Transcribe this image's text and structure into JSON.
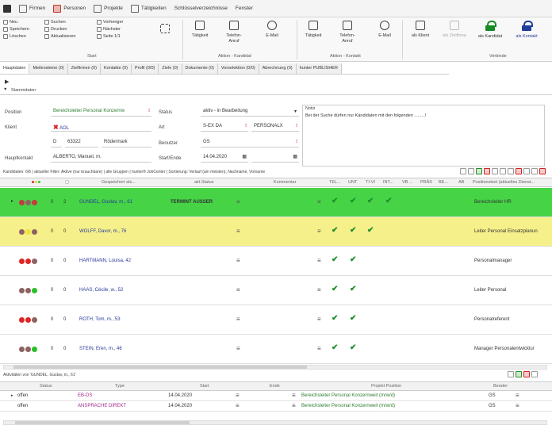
{
  "menubar": {
    "items": [
      "Firmen",
      "Personen",
      "Projekte",
      "Tätigkeiten",
      "Schlüsselverzeichnisse",
      "Fenster"
    ]
  },
  "ribbon": {
    "col1": [
      "Neu",
      "Speichern",
      "Löschen"
    ],
    "col2": [
      "Suchen",
      "Drucken",
      "Aktualisieren"
    ],
    "col3": [
      "Vorheriger",
      "Nächster",
      "Seite 1/1"
    ],
    "start_label": "Start",
    "kandidat_buttons": [
      {
        "label": "Tätigkeit"
      },
      {
        "label": "Telefon-Anruf"
      },
      {
        "label": "E-Mail"
      }
    ],
    "kandidat_label": "Aktion - Kandidat",
    "kontakt_buttons": [
      {
        "label": "Tätigkeit"
      },
      {
        "label": "Telefon-Anruf"
      },
      {
        "label": "E-Mail"
      }
    ],
    "kontakt_label": "Aktion - Kontakt",
    "klient": "als Klient",
    "zielfirma": "als Zielfirma",
    "kandidat": "als Kandidat",
    "kontakt": "als Kontakt",
    "verbinde_label": "Verbinde"
  },
  "tabs": [
    "Hauptdaten",
    "Meilensteine (0)",
    "Zielfirmen (0)",
    "Kontakte (0)",
    "Profil (0/0)",
    "Ziele (0)",
    "Dokumente (0)",
    "Vorselektion (0/0)",
    "Abrechnung (0)",
    "hunter PUBLISHER"
  ],
  "section": {
    "title": "Stammdaten"
  },
  "form": {
    "position_label": "Position",
    "position_value": "Bereichsleiter Personal Konzernw",
    "klient_label": "Klient",
    "klient_value": "AOL",
    "klient_country": "D",
    "klient_zip": "63322",
    "klient_city": "Rödermark",
    "hauptkontakt_label": "Hauptkontakt",
    "hauptkontakt_value": "ALBERTO, Manuel, m.",
    "status_label": "Status",
    "status_value": "aktiv - in Bearbeitung",
    "art_label": "Art",
    "art_value1": "S-EX DA",
    "art_value2": "PERSONALX",
    "benutzer_label": "Benutzer",
    "benutzer_value": "GS",
    "start_label": "Start/Ende",
    "start_value": "14.04.2020",
    "notes_label": "Notiz",
    "notes_value": "Bei der Suche dürfen nur Kandidaten mit den folgenden .........!"
  },
  "filter_text": "Kandidaten: 6/6 | aktueller Filter: Aktive (nur brauchbare) | alle Gruppen | hunter® JobCenter | Sortierung: Verlauf (am meisten), Nachname, Vorname",
  "grid": {
    "headers": [
      "Gespeichert als...",
      "akt.Status",
      "Kommentar",
      "TEL...",
      "UNT",
      "TI-VI",
      "INT...",
      "VB ...",
      "PRÄS",
      "BE...",
      "AB",
      "Positionstext (aktuelles Dienst..."
    ],
    "rows": [
      {
        "count": "0",
        "num": "2",
        "name": "GUNDEL, Gustav, m., 61",
        "status": "TERMINT AUSSER",
        "position": "Bereichsleiter HR",
        "checks": 4,
        "color": "#46d346",
        "dots": [
          "#c43b3b",
          "#8e6262",
          "#c43b3b"
        ]
      },
      {
        "count": "0",
        "num": "0",
        "name": "WOLFF, Davor, m., 76",
        "status": "",
        "position": "Leiter Personal Einsatzplanun",
        "checks": 3,
        "color": "#f5f08a",
        "dots": [
          "#8e6262",
          "#f3e13c",
          "#8e6262"
        ]
      },
      {
        "count": "0",
        "num": "0",
        "name": "HARTMANN, Louisa, 42",
        "status": "",
        "position": "Personalmanager",
        "checks": 2,
        "color": "#ffffff",
        "dots": [
          "#e02424",
          "#e02424",
          "#8e6262"
        ]
      },
      {
        "count": "0",
        "num": "0",
        "name": "HAAS, Cécile, w., 52",
        "status": "",
        "position": "Leiter Personal",
        "checks": 2,
        "color": "#ffffff",
        "dots": [
          "#8e6262",
          "#8e6262",
          "#28c028"
        ]
      },
      {
        "count": "0",
        "num": "0",
        "name": "ROTH, Tom, m., 53",
        "status": "",
        "position": "Personalreferent",
        "checks": 2,
        "color": "#ffffff",
        "dots": [
          "#e02424",
          "#e02424",
          "#8e6262"
        ]
      },
      {
        "count": "0",
        "num": "0",
        "name": "STEIN, Eren, m., 46",
        "status": "",
        "position": "Manager Personalentwicklur",
        "checks": 2,
        "color": "#ffffff",
        "dots": [
          "#8e6262",
          "#8e6262",
          "#28c028"
        ]
      }
    ]
  },
  "activities": {
    "title": "Aktivitäten von 'GUNDEL, Gustav, m., 61'",
    "headers": [
      "Status",
      "Type",
      "Start",
      "Ende",
      "Projekt Position",
      "Berater"
    ],
    "rows": [
      {
        "status": "offen",
        "type": "EB-DS",
        "start": "14.04.2020",
        "ende": "",
        "position": "Bereichsleiter Personal Konzernweit (m/w/d)",
        "berater": "GS"
      },
      {
        "status": "offen",
        "type": "ANSPRACHE DIREKT",
        "start": "14.04.2020",
        "ende": "",
        "position": "Bereichsleiter Personal Konzernweit (m/w/d)",
        "berater": "GS"
      }
    ]
  }
}
